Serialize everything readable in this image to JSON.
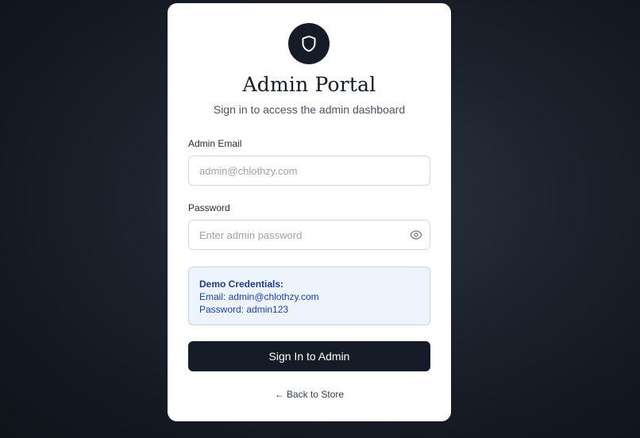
{
  "brand": {
    "title": "Admin Portal",
    "subtitle": "Sign in to access the admin dashboard",
    "logo_icon": "shield-icon"
  },
  "form": {
    "email_label": "Admin Email",
    "email_placeholder": "admin@chlothzy.com",
    "email_value": "",
    "password_label": "Password",
    "password_placeholder": "Enter admin password",
    "password_value": "",
    "password_toggle_icon": "eye-icon"
  },
  "demo": {
    "title": "Demo Credentials:",
    "email_line": "Email: admin@chlothzy.com",
    "password_line": "Password: admin123"
  },
  "actions": {
    "signin_label": "Sign In to Admin",
    "back_arrow": "←",
    "back_label": "Back to Store"
  },
  "colors": {
    "primary": "#161b28",
    "demo_bg": "#eef4fd",
    "demo_border": "#bfd3f1",
    "demo_text": "#1e3a8a"
  }
}
